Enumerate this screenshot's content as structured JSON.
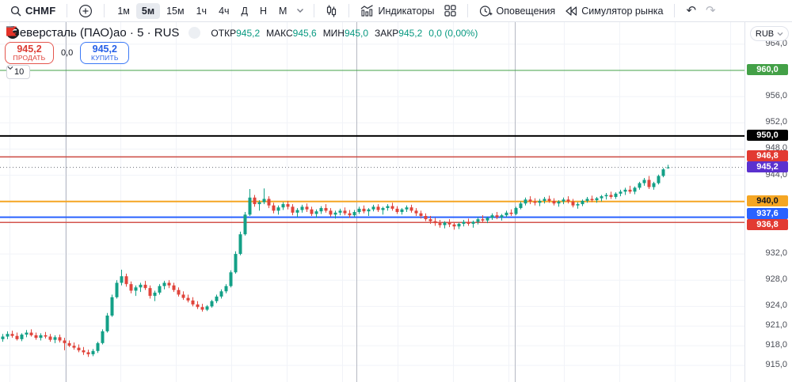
{
  "toolbar": {
    "symbol": "CHMF",
    "timeframes": [
      "1м",
      "5м",
      "15м",
      "1ч",
      "4ч",
      "Д",
      "Н",
      "М"
    ],
    "selected_timeframe": "5м",
    "indicators_label": "Индикаторы",
    "alerts_label": "Оповещения",
    "simulator_label": "Симулятор рынка"
  },
  "legend": {
    "title": "Северсталь (ПАО)ао · 5 · RUS",
    "ohlc": [
      {
        "label": "ОТКР",
        "value": "945,2"
      },
      {
        "label": "МАКС",
        "value": "945,6"
      },
      {
        "label": "МИН",
        "value": "945,0"
      },
      {
        "label": "ЗАКР",
        "value": "945,2"
      }
    ],
    "change": "0,0 (0,00%)"
  },
  "trade_panel": {
    "sell_price": "945,2",
    "sell_label": "ПРОДАТЬ",
    "spread": "0,0",
    "buy_price": "945,2",
    "buy_label": "КУПИТЬ"
  },
  "lot_selector": {
    "value": "10"
  },
  "price_axis": {
    "currency": "RUB",
    "ticks": [
      {
        "label": "964,0",
        "price": 964
      },
      {
        "label": "956,0",
        "price": 956
      },
      {
        "label": "952,0",
        "price": 952
      },
      {
        "label": "948,0",
        "price": 948
      },
      {
        "label": "944,0",
        "price": 944
      },
      {
        "label": "932,0",
        "price": 932
      },
      {
        "label": "928,0",
        "price": 928
      },
      {
        "label": "924,0",
        "price": 924
      },
      {
        "label": "921,0",
        "price": 921
      },
      {
        "label": "918,0",
        "price": 918
      },
      {
        "label": "915,0",
        "price": 915
      }
    ],
    "badges": [
      {
        "label": "960,0",
        "price": 960,
        "bg": "#43a047",
        "fg": "#ffffff",
        "dy": 0
      },
      {
        "label": "950,0",
        "price": 950,
        "bg": "#000000",
        "fg": "#ffffff",
        "dy": 0
      },
      {
        "label": "946,8",
        "price": 946.8,
        "bg": "#e23a32",
        "fg": "#ffffff",
        "dy": 0
      },
      {
        "label": "945,2",
        "price": 945.2,
        "bg": "#5b31cf",
        "fg": "#ffffff",
        "dy": 0
      },
      {
        "label": "940,0",
        "price": 940,
        "bg": "#f5a623",
        "fg": "#131722",
        "dy": 0
      },
      {
        "label": "937,6",
        "price": 937.6,
        "bg": "#2962ff",
        "fg": "#ffffff",
        "dy": -4
      },
      {
        "label": "936,8",
        "price": 936.8,
        "bg": "#e23a32",
        "fg": "#ffffff",
        "dy": 4
      }
    ]
  },
  "chart_data": {
    "type": "candlestick",
    "title": "Северсталь (ПАО)ао · 5 · RUS",
    "symbol": "CHMF",
    "interval": "5",
    "exchange": "RUS",
    "currency": "RUB",
    "ylim": [
      915,
      964.4
    ],
    "up_color": "#13a087",
    "down_color": "#e0453c",
    "grid_prices": [
      964,
      956,
      952,
      948,
      944,
      932,
      928,
      924,
      921,
      918,
      915
    ],
    "session_breaks_x": [
      83,
      450,
      650
    ],
    "levels": [
      {
        "price": 960,
        "color": "#43a047",
        "width": 1,
        "style": "solid"
      },
      {
        "price": 950,
        "color": "#000000",
        "width": 2,
        "style": "solid"
      },
      {
        "price": 946.8,
        "color": "#cc4841",
        "width": 1.5,
        "style": "solid"
      },
      {
        "price": 945.2,
        "color": "#6a6d78",
        "width": 1,
        "style": "dotted"
      },
      {
        "price": 940,
        "color": "#f5a623",
        "width": 2,
        "style": "solid"
      },
      {
        "price": 937.6,
        "color": "#2962ff",
        "width": 2,
        "style": "solid"
      },
      {
        "price": 936.8,
        "color": "#d4544d",
        "width": 1.5,
        "style": "solid"
      }
    ],
    "candles": [
      [
        919.0,
        919.8,
        918.6,
        919.4
      ],
      [
        919.4,
        920.2,
        919.0,
        919.8
      ],
      [
        919.8,
        920.3,
        919.2,
        919.5
      ],
      [
        919.5,
        920.0,
        918.8,
        919.0
      ],
      [
        919.0,
        919.9,
        918.7,
        919.7
      ],
      [
        919.7,
        920.4,
        919.3,
        920.0
      ],
      [
        920.0,
        920.5,
        919.4,
        919.6
      ],
      [
        919.6,
        920.0,
        918.9,
        919.2
      ],
      [
        919.2,
        919.9,
        918.8,
        919.6
      ],
      [
        919.6,
        920.1,
        919.1,
        919.4
      ],
      [
        919.4,
        919.8,
        918.6,
        918.9
      ],
      [
        918.9,
        919.6,
        918.4,
        919.3
      ],
      [
        919.3,
        919.7,
        918.5,
        918.8
      ],
      [
        918.8,
        919.2,
        917.3,
        918.4
      ],
      [
        918.4,
        918.8,
        917.8,
        918.0
      ],
      [
        918.0,
        918.5,
        917.4,
        917.7
      ],
      [
        917.7,
        918.2,
        917.0,
        917.3
      ],
      [
        917.3,
        917.8,
        916.6,
        917.0
      ],
      [
        917.0,
        917.4,
        916.3,
        916.7
      ],
      [
        916.7,
        917.5,
        916.4,
        917.2
      ],
      [
        917.2,
        918.6,
        916.9,
        918.4
      ],
      [
        918.4,
        920.5,
        918.2,
        920.2
      ],
      [
        920.2,
        923.0,
        920.0,
        922.6
      ],
      [
        922.6,
        925.8,
        922.4,
        925.4
      ],
      [
        925.4,
        928.0,
        925.2,
        927.6
      ],
      [
        927.6,
        929.6,
        927.2,
        928.6
      ],
      [
        928.6,
        929.0,
        927.0,
        927.4
      ],
      [
        927.4,
        927.8,
        926.0,
        926.4
      ],
      [
        926.4,
        927.2,
        925.6,
        926.9
      ],
      [
        926.9,
        927.6,
        926.2,
        927.3
      ],
      [
        927.3,
        927.9,
        926.5,
        926.8
      ],
      [
        926.8,
        927.2,
        925.2,
        925.6
      ],
      [
        925.6,
        926.4,
        924.8,
        926.1
      ],
      [
        926.1,
        927.4,
        925.8,
        927.1
      ],
      [
        927.1,
        927.9,
        926.6,
        927.6
      ],
      [
        927.6,
        928.0,
        926.8,
        927.2
      ],
      [
        927.2,
        927.6,
        926.2,
        926.5
      ],
      [
        926.5,
        926.9,
        925.5,
        925.8
      ],
      [
        925.8,
        926.3,
        925.0,
        925.3
      ],
      [
        925.3,
        925.8,
        924.6,
        924.9
      ],
      [
        924.9,
        925.4,
        924.0,
        924.3
      ],
      [
        924.3,
        924.8,
        923.6,
        923.9
      ],
      [
        923.9,
        924.4,
        923.2,
        923.5
      ],
      [
        923.5,
        924.2,
        923.3,
        924.0
      ],
      [
        924.0,
        925.0,
        923.8,
        924.8
      ],
      [
        924.8,
        925.8,
        924.5,
        925.5
      ],
      [
        925.5,
        926.6,
        925.2,
        926.3
      ],
      [
        926.3,
        927.4,
        926.0,
        927.1
      ],
      [
        927.1,
        929.5,
        926.9,
        929.2
      ],
      [
        929.2,
        932.4,
        929.0,
        932.0
      ],
      [
        932.0,
        935.4,
        931.8,
        935.0
      ],
      [
        935.0,
        938.4,
        934.8,
        938.0
      ],
      [
        938.0,
        941.9,
        937.8,
        940.6
      ],
      [
        940.6,
        941.0,
        939.2,
        939.6
      ],
      [
        939.6,
        940.2,
        938.6,
        939.9
      ],
      [
        939.9,
        942.0,
        939.6,
        940.4
      ],
      [
        940.4,
        940.8,
        939.0,
        939.4
      ],
      [
        939.4,
        939.8,
        938.2,
        938.6
      ],
      [
        938.6,
        939.4,
        938.0,
        939.1
      ],
      [
        939.1,
        939.9,
        938.7,
        939.6
      ],
      [
        939.6,
        940.1,
        938.8,
        939.2
      ],
      [
        939.2,
        939.6,
        937.9,
        938.3
      ],
      [
        938.3,
        939.0,
        937.6,
        938.7
      ],
      [
        938.7,
        939.5,
        938.3,
        939.2
      ],
      [
        939.2,
        939.7,
        938.4,
        938.8
      ],
      [
        938.8,
        939.2,
        937.8,
        938.1
      ],
      [
        938.1,
        938.8,
        937.5,
        938.5
      ],
      [
        938.5,
        939.3,
        938.1,
        939.0
      ],
      [
        939.0,
        939.6,
        938.3,
        938.6
      ],
      [
        938.6,
        939.0,
        937.7,
        938.0
      ],
      [
        938.0,
        938.6,
        937.4,
        938.3
      ],
      [
        938.3,
        938.9,
        937.9,
        938.6
      ],
      [
        938.6,
        939.1,
        937.9,
        938.2
      ],
      [
        938.2,
        938.7,
        937.5,
        937.9
      ],
      [
        937.9,
        938.7,
        937.6,
        938.4
      ],
      [
        938.4,
        939.2,
        938.1,
        938.9
      ],
      [
        938.9,
        939.4,
        938.2,
        938.5
      ],
      [
        938.5,
        939.0,
        937.8,
        938.8
      ],
      [
        938.8,
        939.5,
        938.5,
        939.2
      ],
      [
        939.2,
        939.6,
        938.4,
        938.7
      ],
      [
        938.7,
        939.2,
        938.0,
        939.0
      ],
      [
        939.0,
        939.6,
        938.6,
        939.3
      ],
      [
        939.3,
        939.8,
        938.6,
        938.9
      ],
      [
        938.9,
        939.3,
        938.1,
        938.4
      ],
      [
        938.4,
        939.0,
        938.0,
        938.8
      ],
      [
        938.8,
        939.4,
        938.4,
        939.1
      ],
      [
        939.1,
        939.5,
        938.3,
        938.6
      ],
      [
        938.6,
        939.0,
        937.8,
        938.2
      ],
      [
        938.2,
        938.6,
        937.4,
        937.8
      ],
      [
        937.8,
        938.2,
        937.0,
        937.3
      ],
      [
        937.3,
        937.8,
        936.6,
        937.0
      ],
      [
        937.0,
        937.5,
        936.3,
        936.7
      ],
      [
        936.7,
        937.2,
        936.0,
        936.4
      ],
      [
        936.4,
        937.0,
        935.9,
        936.8
      ],
      [
        936.8,
        937.3,
        936.1,
        936.5
      ],
      [
        936.5,
        936.9,
        935.7,
        936.2
      ],
      [
        936.2,
        936.8,
        935.8,
        936.6
      ],
      [
        936.6,
        937.2,
        936.2,
        936.9
      ],
      [
        936.9,
        937.4,
        936.3,
        936.6
      ],
      [
        936.6,
        937.1,
        936.0,
        936.9
      ],
      [
        936.9,
        937.6,
        936.5,
        937.3
      ],
      [
        937.3,
        937.9,
        936.8,
        937.1
      ],
      [
        937.1,
        937.7,
        936.7,
        937.5
      ],
      [
        937.5,
        938.2,
        937.2,
        937.9
      ],
      [
        937.9,
        938.4,
        937.3,
        937.6
      ],
      [
        937.6,
        938.1,
        937.1,
        937.9
      ],
      [
        937.9,
        938.6,
        937.6,
        938.3
      ],
      [
        938.3,
        938.8,
        937.8,
        938.1
      ],
      [
        938.1,
        939.2,
        937.9,
        939.0
      ],
      [
        939.0,
        940.0,
        938.8,
        939.7
      ],
      [
        939.7,
        940.6,
        939.4,
        940.3
      ],
      [
        940.3,
        940.8,
        939.6,
        940.0
      ],
      [
        940.0,
        940.5,
        939.4,
        939.8
      ],
      [
        939.8,
        940.4,
        939.3,
        940.1
      ],
      [
        940.1,
        940.7,
        939.7,
        940.4
      ],
      [
        940.4,
        940.9,
        939.8,
        940.1
      ],
      [
        940.1,
        940.5,
        939.4,
        939.7
      ],
      [
        939.7,
        940.2,
        939.2,
        940.0
      ],
      [
        940.0,
        940.6,
        939.6,
        940.3
      ],
      [
        940.3,
        940.8,
        939.7,
        940.0
      ],
      [
        940.0,
        940.4,
        939.1,
        939.4
      ],
      [
        939.4,
        939.9,
        938.9,
        939.6
      ],
      [
        939.6,
        940.3,
        939.3,
        940.1
      ],
      [
        940.1,
        940.7,
        939.8,
        940.4
      ],
      [
        940.4,
        940.9,
        939.9,
        940.2
      ],
      [
        940.2,
        940.7,
        939.8,
        940.5
      ],
      [
        940.5,
        941.0,
        940.0,
        940.8
      ],
      [
        940.8,
        941.3,
        940.3,
        941.0
      ],
      [
        941.0,
        941.5,
        940.4,
        940.7
      ],
      [
        940.7,
        941.4,
        940.4,
        941.2
      ],
      [
        941.2,
        941.8,
        940.8,
        941.5
      ],
      [
        941.5,
        942.1,
        941.0,
        941.8
      ],
      [
        941.8,
        942.4,
        941.2,
        941.5
      ],
      [
        941.5,
        942.3,
        941.1,
        942.1
      ],
      [
        942.1,
        943.0,
        941.8,
        942.8
      ],
      [
        942.8,
        943.6,
        942.4,
        943.3
      ],
      [
        943.3,
        943.9,
        941.9,
        942.2
      ],
      [
        942.2,
        943.0,
        941.8,
        942.8
      ],
      [
        942.8,
        944.1,
        942.6,
        943.9
      ],
      [
        943.9,
        945.1,
        943.7,
        944.9
      ],
      [
        945.2,
        945.6,
        945.0,
        945.2
      ]
    ]
  }
}
